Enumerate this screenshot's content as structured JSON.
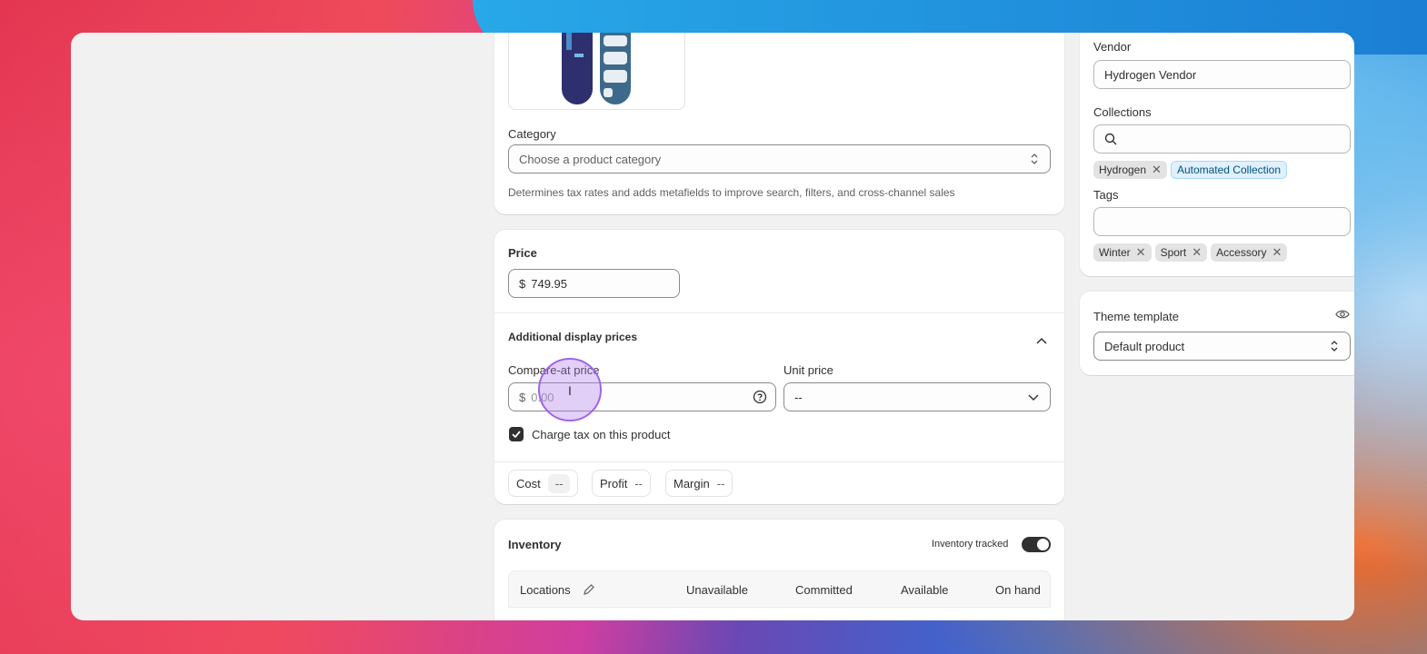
{
  "product_media": {
    "alt": "snowboard"
  },
  "category": {
    "label": "Category",
    "placeholder": "Choose a product category",
    "help": "Determines tax rates and adds metafields to improve search, filters, and cross-channel sales"
  },
  "price": {
    "label": "Price",
    "currency": "$",
    "value": "749.95"
  },
  "additional": {
    "title": "Additional display prices",
    "compare_label": "Compare-at price",
    "compare_currency": "$",
    "compare_placeholder": "0.00",
    "unit_label": "Unit price",
    "unit_value": "--",
    "tax_label": "Charge tax on this product"
  },
  "metrics": {
    "cost_label": "Cost",
    "cost_value": "--",
    "profit_label": "Profit",
    "profit_value": "--",
    "margin_label": "Margin",
    "margin_value": "--"
  },
  "inventory": {
    "title": "Inventory",
    "tracked_label": "Inventory tracked",
    "columns": [
      "Locations",
      "Unavailable",
      "Committed",
      "Available",
      "On hand"
    ]
  },
  "organization": {
    "vendor_label": "Vendor",
    "vendor_value": "Hydrogen Vendor",
    "collections_label": "Collections",
    "collections": [
      "Hydrogen",
      "Automated Collection"
    ],
    "tags_label": "Tags",
    "tags": [
      "Winter",
      "Sport",
      "Accessory"
    ]
  },
  "theme": {
    "label": "Theme template",
    "value": "Default product"
  },
  "colors": {
    "accent_cursor": "#a064e6",
    "dark": "#303030"
  }
}
